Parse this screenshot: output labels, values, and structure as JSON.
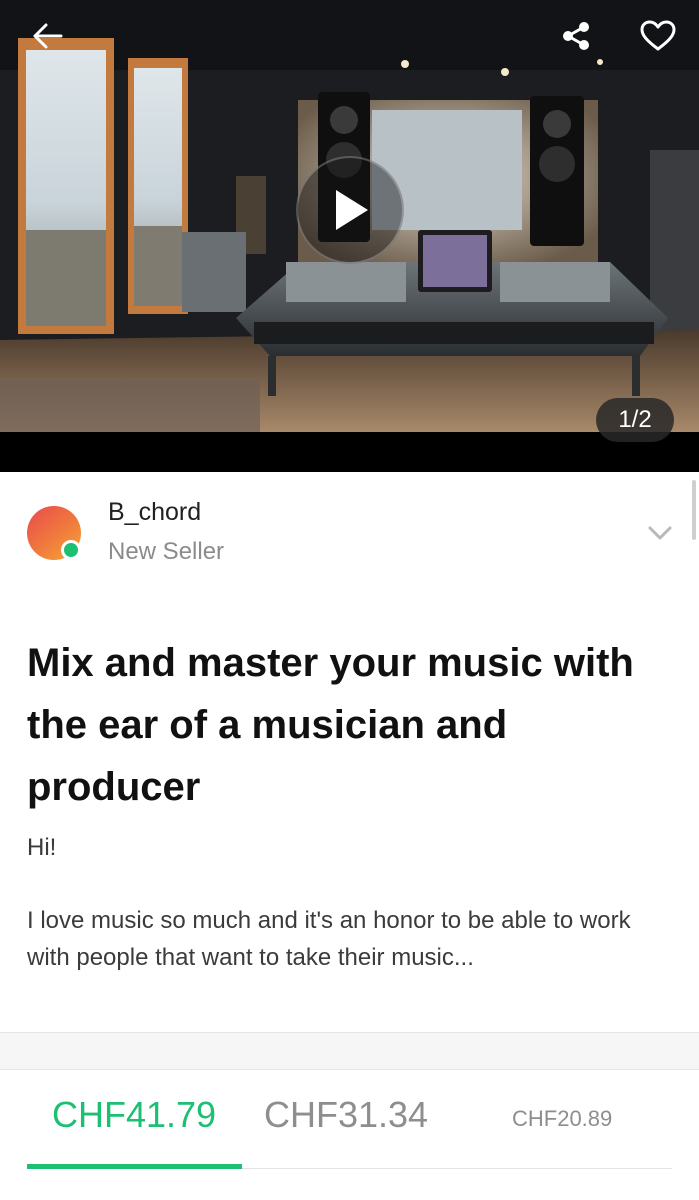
{
  "hero": {
    "page_counter": "1/2",
    "icons": {
      "back": "arrow-left-icon",
      "share": "share-icon",
      "favorite": "heart-outline-icon",
      "play": "play-icon"
    }
  },
  "seller": {
    "name": "B_chord",
    "level": "New Seller",
    "online": true,
    "online_color": "#1dbf73"
  },
  "gig": {
    "title": "Mix and master your music with the ear of a musician and producer",
    "greeting": "Hi!",
    "description": "I love music so much and it's an honor to be able to work with people that want to take their music..."
  },
  "pricing": {
    "accent_color": "#1dbf73",
    "selected_tab": 0,
    "tabs": [
      {
        "price": "CHF41.79"
      },
      {
        "price": "CHF31.34"
      },
      {
        "price": "CHF20.89"
      }
    ]
  }
}
